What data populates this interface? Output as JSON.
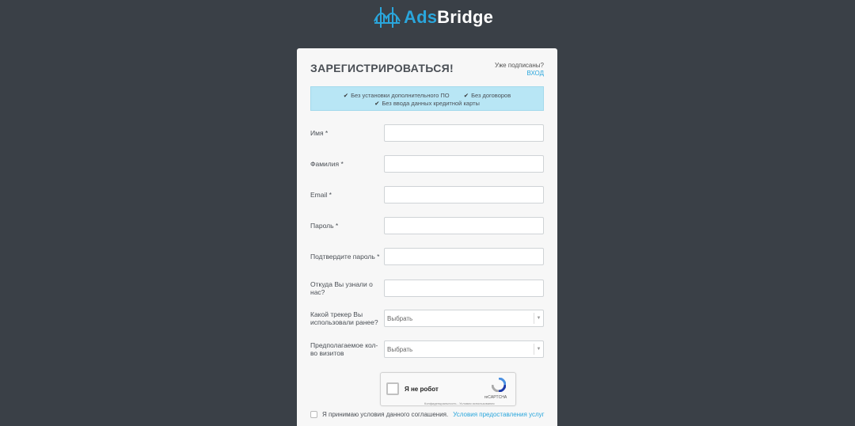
{
  "logo": {
    "part1": "Ads",
    "part2": "Bridge"
  },
  "form": {
    "title": "ЗАРЕГИСТРИРОВАТЬСЯ!",
    "already_subscribed": "Уже подписаны?",
    "login_link": "ВХОД",
    "benefits": [
      "Без установки дополнительного ПО",
      "Без договоров",
      "Без ввода данных кредитной карты"
    ],
    "fields": [
      {
        "label": "Имя *",
        "value": ""
      },
      {
        "label": "Фамилия *",
        "value": ""
      },
      {
        "label": "Email *",
        "value": ""
      },
      {
        "label": "Пароль *",
        "value": ""
      },
      {
        "label": "Подтвердите пароль *",
        "value": ""
      },
      {
        "label": "Откуда Вы узнали о нас?",
        "value": ""
      }
    ],
    "selects": [
      {
        "label": "Какой трекер Вы использовали ранее?",
        "value": "Выбрать"
      },
      {
        "label": "Предполагаемое кол-во визитов",
        "value": "Выбрать"
      }
    ],
    "captcha": {
      "label": "Я не робот",
      "brand": "reCAPTCHA",
      "terms": "Конфиденциальность - Условия использования"
    },
    "agree": {
      "text": "Я принимаю условия данного соглашения.",
      "link": "Условия предоставления услуг"
    }
  },
  "colors": {
    "background": "#3a4047",
    "accent": "#2aa6dc",
    "benefits_bg": "#b8e6f5"
  }
}
